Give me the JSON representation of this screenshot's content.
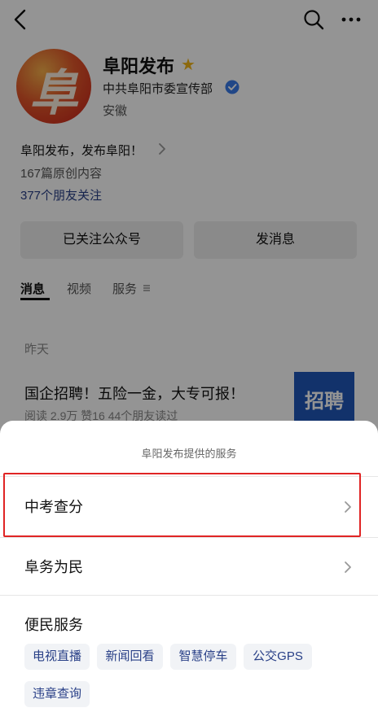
{
  "profile": {
    "name": "阜阳发布",
    "org": "中共阜阳市委宣传部",
    "region": "安徽",
    "slogan": "阜阳发布，发布阜阳！",
    "original_count": "167篇原创内容",
    "friends_following": "377个朋友关注",
    "avatar_glyph": "阜",
    "icons": {
      "back": "back-arrow-icon",
      "search": "search-icon",
      "more": "more-icon",
      "star": "star-icon",
      "verified": "verified-icon"
    },
    "colors": {
      "star": "#f2b619",
      "verified": "#3a7be8",
      "link": "#283f87"
    }
  },
  "actions": {
    "follow_label": "已关注公众号",
    "message_label": "发消息"
  },
  "tabs": [
    {
      "label": "消息",
      "active": true
    },
    {
      "label": "视频",
      "active": false
    },
    {
      "label": "服务",
      "active": false
    }
  ],
  "feed": {
    "date": "昨天",
    "article_title": "国企招聘！五险一金，大专可报！",
    "article_meta": "阅读 2.9万   赞16   44个朋友读过",
    "thumb_text": "招聘"
  },
  "sheet": {
    "title": "阜阳发布提供的服务",
    "items": [
      {
        "label": "中考查分",
        "highlighted": true
      },
      {
        "label": "阜务为民",
        "highlighted": false
      }
    ],
    "section_title": "便民服务",
    "tags": [
      "电视直播",
      "新闻回看",
      "智慧停车",
      "公交GPS",
      "违章查询"
    ],
    "colors": {
      "highlight": "#e02424",
      "tag_text": "#283f87"
    }
  }
}
